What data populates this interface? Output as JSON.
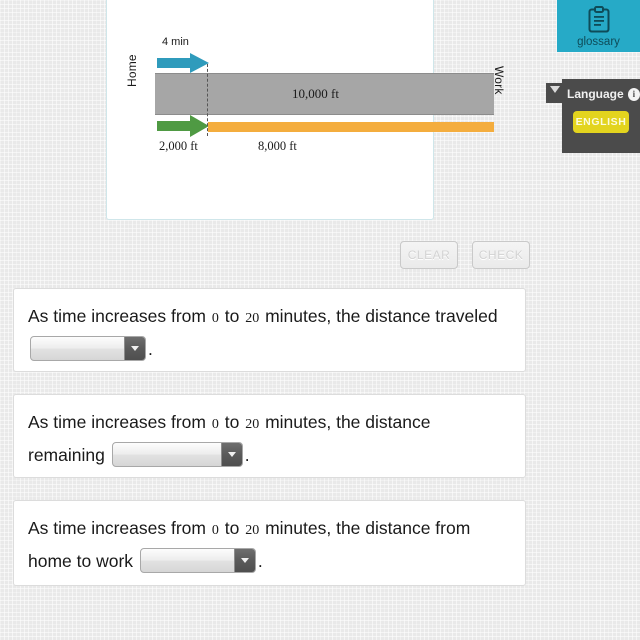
{
  "diagram": {
    "title_alt": "distance-from-home-to-work-diagram",
    "top_time_label": "4 min",
    "home_label": "Home",
    "work_label": "Work",
    "total_distance_label": "10,000 ft",
    "traveled_distance_label": "2,000 ft",
    "remaining_distance_label": "8,000 ft",
    "colors": {
      "blue_arrow": "#2f9bbc",
      "green_arrow": "#4f9a43",
      "orange_bar": "#f4ad3e",
      "gray_bar": "#a6a6a6",
      "panel_border": "#cfe6ea"
    }
  },
  "actions": {
    "clear_label": "CLEAR",
    "check_label": "CHECK"
  },
  "questions": [
    {
      "text_before": "As time increases from",
      "num_start": "0",
      "text_mid": "to",
      "num_end": "20",
      "text_after": "minutes, the distance traveled",
      "dropdown_value": "",
      "dropdown_placeholder": "",
      "period": "."
    },
    {
      "text_before": "As time increases from",
      "num_start": "0",
      "text_mid": "to",
      "num_end": "20",
      "text_after": "minutes, the distance remaining",
      "dropdown_value": "",
      "dropdown_placeholder": "",
      "period": "."
    },
    {
      "text_before": "As time increases from",
      "num_start": "0",
      "text_mid": "to",
      "num_end": "20",
      "text_after": "minutes, the distance from home to work",
      "dropdown_value": "",
      "dropdown_placeholder": "",
      "period": "."
    }
  ],
  "sidebar": {
    "glossary_label": "glossary",
    "glossary_icon": "clipboard-icon",
    "glossary_color": "#26aac7",
    "language_title": "Language",
    "language_info_icon": "i",
    "language_selected": "ENGLISH",
    "language_button_color": "#e3d41e",
    "panel_color": "#4b4b4b"
  }
}
